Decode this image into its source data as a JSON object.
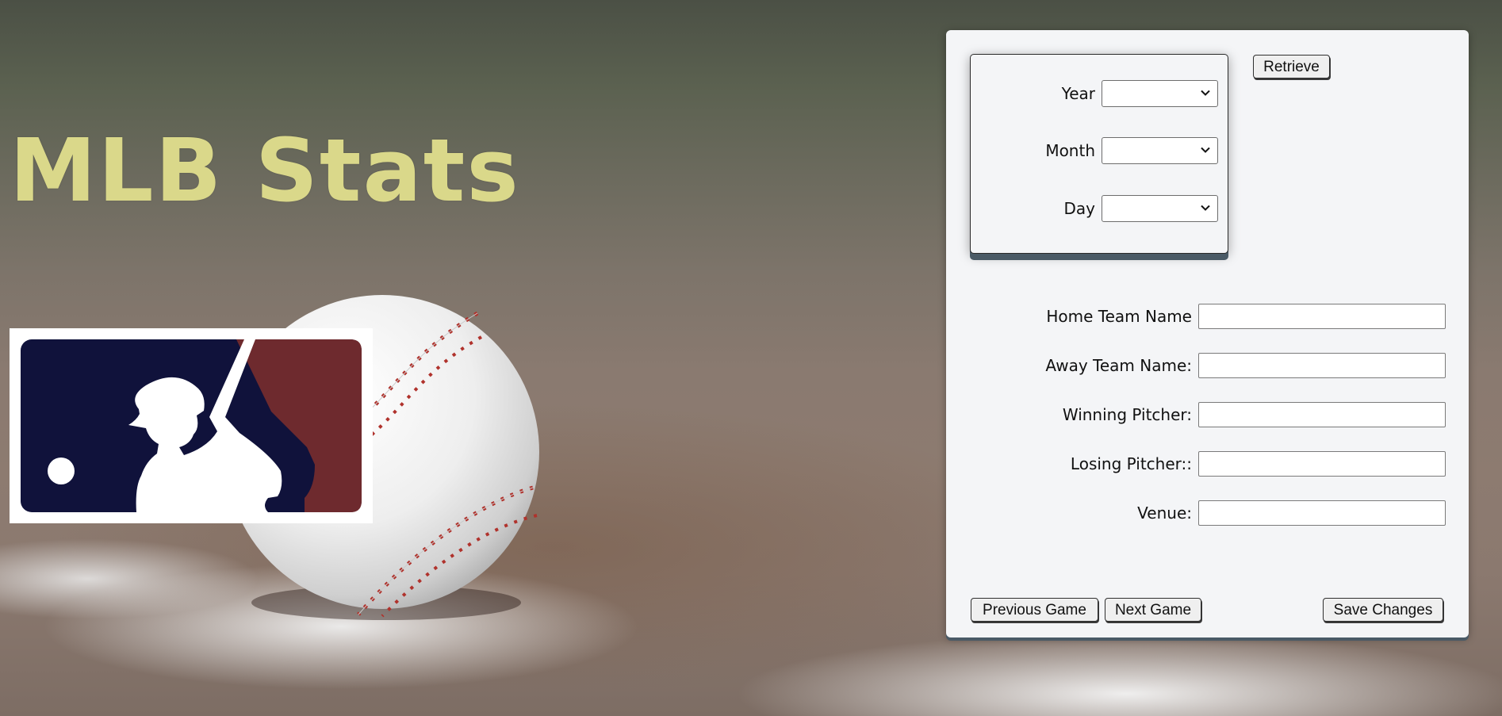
{
  "title": "MLB Stats",
  "date_picker": {
    "year_label": "Year",
    "month_label": "Month",
    "day_label": "Day",
    "year_value": "",
    "month_value": "",
    "day_value": ""
  },
  "retrieve_label": "Retrieve",
  "fields": {
    "home_team_label": "Home Team Name",
    "home_team_value": "",
    "away_team_label": "Away Team Name:",
    "away_team_value": "",
    "winning_pitcher_label": "Winning Pitcher:",
    "winning_pitcher_value": "",
    "losing_pitcher_label": "Losing Pitcher::",
    "losing_pitcher_value": "",
    "venue_label": "Venue:",
    "venue_value": ""
  },
  "buttons": {
    "previous_game": "Previous Game",
    "next_game": "Next Game",
    "save_changes": "Save Changes"
  },
  "colors": {
    "title": "#dad88a",
    "logo_navy": "#10123b",
    "logo_red": "#6e2a2e",
    "panel_bg": "#f4f5f7",
    "panel_shadow": "#4a5a66"
  },
  "icons": {
    "logo": "mlb-batter-logo",
    "select_arrow": "chevron-down-icon"
  }
}
